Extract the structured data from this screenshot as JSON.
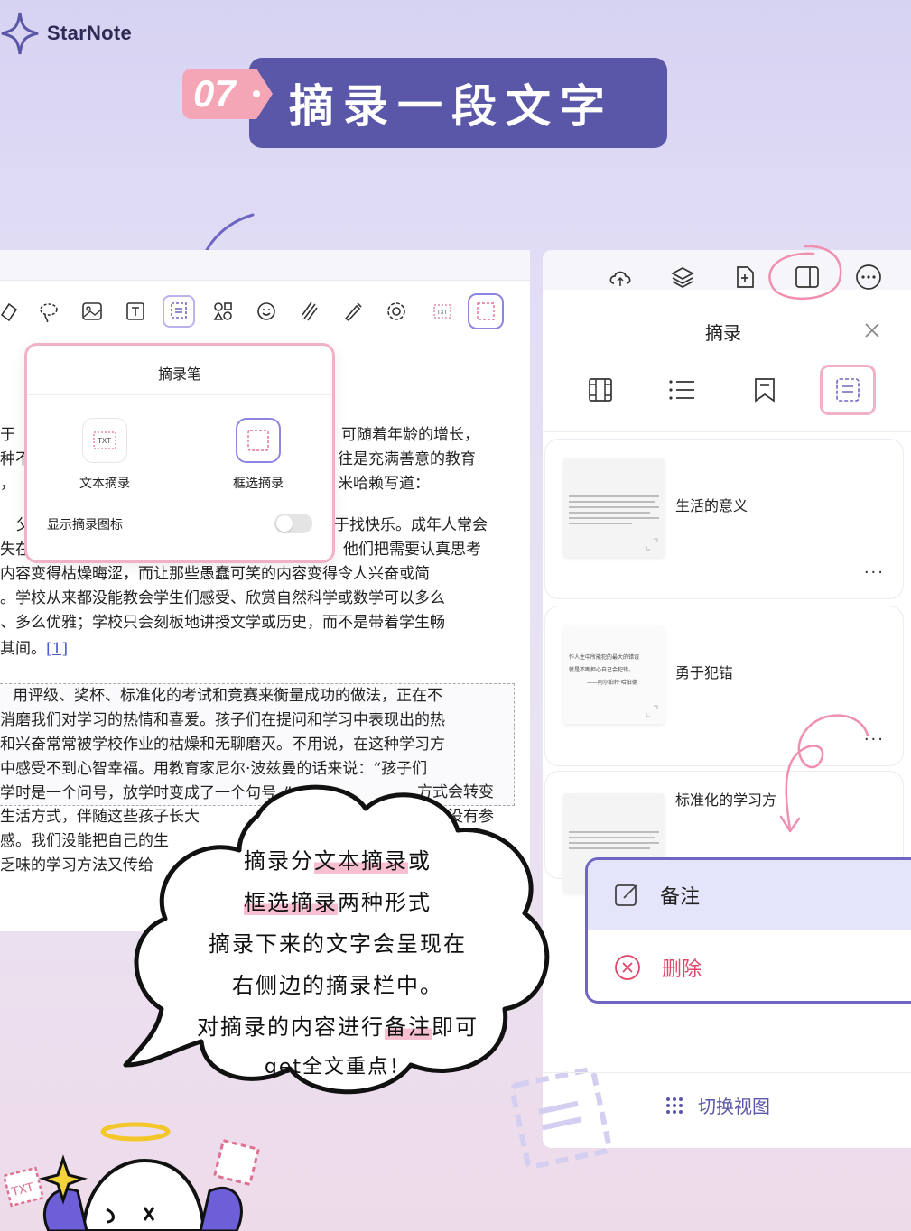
{
  "brand": {
    "name": "StarNote"
  },
  "banner": {
    "number": "07",
    "title": "摘录一段文字"
  },
  "toolbar": {
    "icons": [
      "eraser-icon",
      "lasso-icon",
      "image-icon",
      "textbox-icon",
      "excerpt-pen-icon",
      "shapes-icon",
      "sticker-icon",
      "tape-icon",
      "laser-pen-icon",
      "settings-icon",
      "txt-excerpt-icon",
      "box-excerpt-icon"
    ]
  },
  "document": {
    "lines_top": [
      {
        "left": "于",
        "right": "可随着年龄的增长，"
      },
      {
        "left": "种不",
        "right": "往是充满善意的教育"
      },
      {
        "left": "，",
        "right": "米哈赖写道："
      }
    ],
    "lines_mid_right": [
      "于找快乐。成年人常会",
      "他们把需要认真思考"
    ],
    "lines_mid_left": [
      "父",
      "失在"
    ],
    "lines_full": [
      "内容变得枯燥晦涩，而让那些愚蠢可笑的内容变得令人兴奋或简",
      "。学校从来都没能教会学生们感受、欣赏自然科学或数学可以多么",
      "、多么优雅；学校只会刻板地讲授文学或历史，而不是带着学生畅"
    ],
    "line_end": "其间。",
    "footnote": "[1]",
    "quote_lines": [
      "用评级、奖杯、标准化的考试和竞赛来衡量成功的做法，正在不",
      "消磨我们对学习的热情和喜爱。孩子们在提问和学习中表现出的热",
      "和兴奋常常被学校作业的枯燥和无聊磨灭。不用说，在这种学习方",
      "中感受不到心智幸福。用教育家尼尔·波兹曼的话来说：“孩子们",
      "学时是一个问号，放学时变成了一个句号。”",
      "生活方式，伴随这些孩子长大",
      "感。我们没能把自己的生",
      "乏味的学习方法又传给"
    ],
    "quote_tail_right": [
      "方式会转变",
      "没有参",
      "出"
    ]
  },
  "popover": {
    "title": "摘录笔",
    "option_text": "文本摘录",
    "option_box": "框选摘录",
    "toggle_label": "显示摘录图标",
    "toggle_on": false
  },
  "panel": {
    "top_icons": [
      "cloud-sync-icon",
      "layers-icon",
      "add-page-icon",
      "sidebar-panel-icon",
      "more-circle-icon"
    ],
    "title": "摘录",
    "view_tabs": [
      "thumbnail-view-icon",
      "list-view-icon",
      "bookmark-view-icon",
      "excerpt-view-icon"
    ],
    "cards": [
      {
        "title": "生活的意义",
        "more": "···"
      },
      {
        "title": "勇于犯错",
        "more": "···",
        "thumb_lines": [
          "作人生中所能犯的最大的错误",
          "就是不断担心自己会犯错。",
          "——阿尔伯特·哈伯德"
        ]
      },
      {
        "title": "标准化的学习方"
      }
    ],
    "menu": {
      "note": "备注",
      "delete": "删除"
    },
    "switch_view": "切换视图"
  },
  "cloud": {
    "lines": [
      [
        "摘录分",
        "文本摘录",
        "或"
      ],
      [
        "",
        "框选摘录",
        "两种形式"
      ],
      [
        "摘录下来的文字会呈现在",
        "",
        ""
      ],
      [
        "右侧边的摘录栏中。",
        "",
        ""
      ],
      [
        "对摘录的内容进行",
        "备注",
        "即可"
      ],
      [
        "get全文重点！",
        "",
        ""
      ]
    ]
  },
  "colors": {
    "accent": "#5a56a8",
    "pink": "#f2b2c6",
    "delete": "#e0466a"
  }
}
